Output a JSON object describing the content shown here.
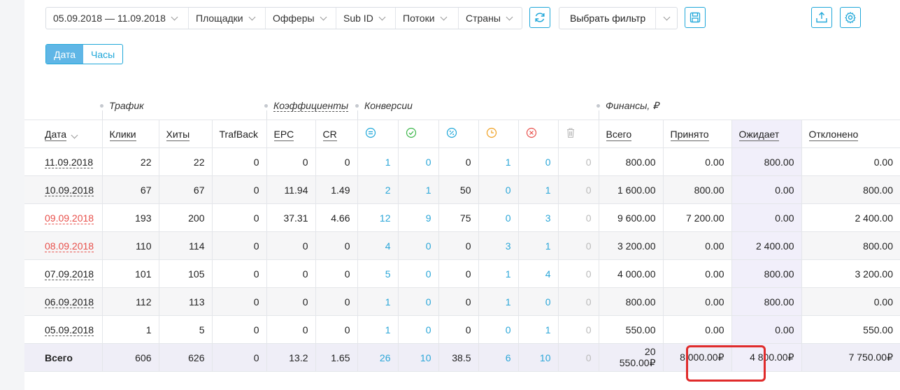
{
  "toolbar": {
    "date_range": "05.09.2018 — 11.09.2018",
    "filters": [
      "Площадки",
      "Офферы",
      "Sub ID",
      "Потоки",
      "Страны"
    ],
    "select_filter_label": "Выбрать фильтр"
  },
  "tabs": [
    {
      "label": "Дата",
      "active": true
    },
    {
      "label": "Часы",
      "active": false
    }
  ],
  "groups": {
    "traffic": "Трафик",
    "coefficients": "Коэффициенты",
    "conversions": "Конверсии",
    "finance": "Финансы, ₽"
  },
  "columns": {
    "date": "Дата",
    "clicks": "Клики",
    "hits": "Хиты",
    "trafback": "TrafBack",
    "epc": "EPC",
    "cr": "CR",
    "conv_icons": [
      "total-conversions-icon",
      "approved-icon",
      "percent-icon",
      "pending-clock-icon",
      "rejected-icon",
      "trash-icon"
    ],
    "total": "Всего",
    "accepted": "Принято",
    "pending": "Ожидает",
    "rejected": "Отклонено"
  },
  "colors": {
    "accent": "#1fa7d9",
    "approved": "#3cb64a",
    "pending": "#f0a020",
    "rejected": "#e8504b",
    "highlight": "#e02b2b"
  },
  "rows": [
    {
      "date": "11.09.2018",
      "weekend": false,
      "clicks": "22",
      "hits": "22",
      "trafback": "0",
      "epc": "0",
      "cr": "0",
      "c1": "1",
      "c2": "0",
      "c3": "0",
      "c4": "1",
      "c5": "0",
      "c6": "0",
      "total": "800.00",
      "accepted": "0.00",
      "pending": "800.00",
      "rejected": "0.00"
    },
    {
      "date": "10.09.2018",
      "weekend": false,
      "clicks": "67",
      "hits": "67",
      "trafback": "0",
      "epc": "11.94",
      "cr": "1.49",
      "c1": "2",
      "c2": "1",
      "c3": "50",
      "c4": "0",
      "c5": "1",
      "c6": "0",
      "total": "1 600.00",
      "accepted": "800.00",
      "pending": "0.00",
      "rejected": "800.00"
    },
    {
      "date": "09.09.2018",
      "weekend": true,
      "clicks": "193",
      "hits": "200",
      "trafback": "0",
      "epc": "37.31",
      "cr": "4.66",
      "c1": "12",
      "c2": "9",
      "c3": "75",
      "c4": "0",
      "c5": "3",
      "c6": "0",
      "total": "9 600.00",
      "accepted": "7 200.00",
      "pending": "0.00",
      "rejected": "2 400.00"
    },
    {
      "date": "08.09.2018",
      "weekend": true,
      "clicks": "110",
      "hits": "114",
      "trafback": "0",
      "epc": "0",
      "cr": "0",
      "c1": "4",
      "c2": "0",
      "c3": "0",
      "c4": "3",
      "c5": "1",
      "c6": "0",
      "total": "3 200.00",
      "accepted": "0.00",
      "pending": "2 400.00",
      "rejected": "800.00"
    },
    {
      "date": "07.09.2018",
      "weekend": false,
      "clicks": "101",
      "hits": "105",
      "trafback": "0",
      "epc": "0",
      "cr": "0",
      "c1": "5",
      "c2": "0",
      "c3": "0",
      "c4": "1",
      "c5": "4",
      "c6": "0",
      "total": "4 000.00",
      "accepted": "0.00",
      "pending": "800.00",
      "rejected": "3 200.00"
    },
    {
      "date": "06.09.2018",
      "weekend": false,
      "clicks": "112",
      "hits": "113",
      "trafback": "0",
      "epc": "0",
      "cr": "0",
      "c1": "1",
      "c2": "0",
      "c3": "0",
      "c4": "1",
      "c5": "0",
      "c6": "0",
      "total": "800.00",
      "accepted": "0.00",
      "pending": "800.00",
      "rejected": "0.00"
    },
    {
      "date": "05.09.2018",
      "weekend": false,
      "clicks": "1",
      "hits": "5",
      "trafback": "0",
      "epc": "0",
      "cr": "0",
      "c1": "1",
      "c2": "0",
      "c3": "0",
      "c4": "0",
      "c5": "1",
      "c6": "0",
      "total": "550.00",
      "accepted": "0.00",
      "pending": "0.00",
      "rejected": "550.00"
    }
  ],
  "totals": {
    "label": "Всего",
    "clicks": "606",
    "hits": "626",
    "trafback": "0",
    "epc": "13.2",
    "cr": "1.65",
    "c1": "26",
    "c2": "10",
    "c3": "38.5",
    "c4": "6",
    "c5": "10",
    "c6": "0",
    "total": "20 550.00₽",
    "accepted": "8 000.00₽",
    "pending": "4 800.00₽",
    "rejected": "7 750.00₽"
  }
}
